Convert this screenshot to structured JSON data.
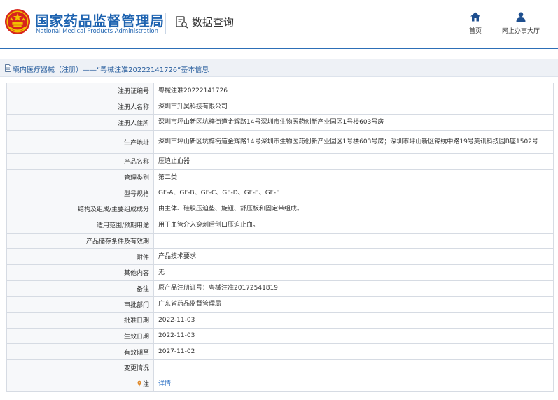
{
  "header": {
    "site_name": "国家药品监督管理局",
    "site_name_en": "National Medical Products Administration",
    "data_query_label": "数据查询",
    "nav": {
      "home_label": "首页",
      "hall_label": "网上办事大厅"
    },
    "colors": {
      "brand": "#1e63b0",
      "emblem_red": "#d7261d",
      "emblem_gold": "#f2c200"
    }
  },
  "breadcrumb": {
    "text": "境内医疗器械（注册）——“粤械注准20222141726”基本信息"
  },
  "record": {
    "rows": [
      {
        "label": "注册证编号",
        "value": "粤械注准20222141726"
      },
      {
        "label": "注册人名称",
        "value": "深圳市升昊科技有限公司"
      },
      {
        "label": "注册人住所",
        "value": "深圳市坪山新区坑梓街道金辉路14号深圳市生物医药创新产业园区1号楼603号房"
      },
      {
        "label": "生产地址",
        "value": "深圳市坪山新区坑梓街道金辉路14号深圳市生物医药创新产业园区1号楼603号房；深圳市坪山新区锦绣中路19号美讯科技园B座1502号"
      },
      {
        "label": "产品名称",
        "value": "压迫止血器"
      },
      {
        "label": "管理类别",
        "value": "第二类"
      },
      {
        "label": "型号规格",
        "value": "GF-A、GF-B、GF-C、GF-D、GF-E、GF-F"
      },
      {
        "label": "结构及组成/主要组成成分",
        "value": "由主体、硅胶压迫垫、旋钮、舒压板和固定带组成。"
      },
      {
        "label": "适用范围/预期用途",
        "value": "用于血管介入穿刺后创口压迫止血。"
      },
      {
        "label": "产品储存条件及有效期",
        "value": ""
      },
      {
        "label": "附件",
        "value": "产品技术要求"
      },
      {
        "label": "其他内容",
        "value": "无"
      },
      {
        "label": "备注",
        "value": "原产品注册证号：粤械注准20172541819"
      },
      {
        "label": "审批部门",
        "value": "广东省药品监督管理局"
      },
      {
        "label": "批准日期",
        "value": "2022-11-03"
      },
      {
        "label": "生效日期",
        "value": "2022-11-03"
      },
      {
        "label": "有效期至",
        "value": "2027-11-02"
      },
      {
        "label": "变更情况",
        "value": ""
      },
      {
        "label": "注",
        "value": "详情",
        "icon": "pin-icon"
      }
    ]
  }
}
